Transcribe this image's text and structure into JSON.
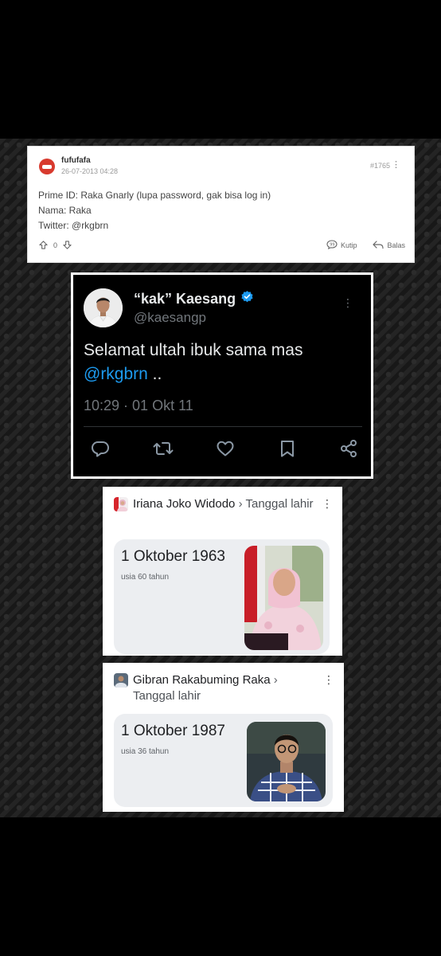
{
  "forum_post": {
    "username": "fufufafa",
    "date": "26-07-2013 04:28",
    "post_number": "#1765",
    "lines": [
      "Prime ID: Raka Gnarly (lupa password, gak bisa log in)",
      "Nama: Raka",
      "Twitter: @rkgbrn"
    ],
    "vote_count": "0",
    "quote_label": "Kutip",
    "reply_label": "Balas"
  },
  "tweet": {
    "display_name": "“kak” Kaesang",
    "handle": "@kaesangp",
    "text": "Selamat ultah ibuk sama mas",
    "mention": "@rkgbrn",
    "text_suffix": " ..",
    "timestamp": "10:29 · 01 Okt 11",
    "colors": {
      "verified": "#1d9bf0",
      "mention": "#1d9bf0"
    }
  },
  "cards": [
    {
      "person": "Iriana Joko Widodo",
      "separator": "›",
      "attribute": "Tanggal lahir",
      "value": "1 Oktober 1963",
      "age": "usia 60 tahun"
    },
    {
      "person": "Gibran Rakabuming Raka",
      "separator": "›",
      "attribute": "Tanggal lahir",
      "value": "1 Oktober 1987",
      "age": "usia 36 tahun"
    }
  ]
}
